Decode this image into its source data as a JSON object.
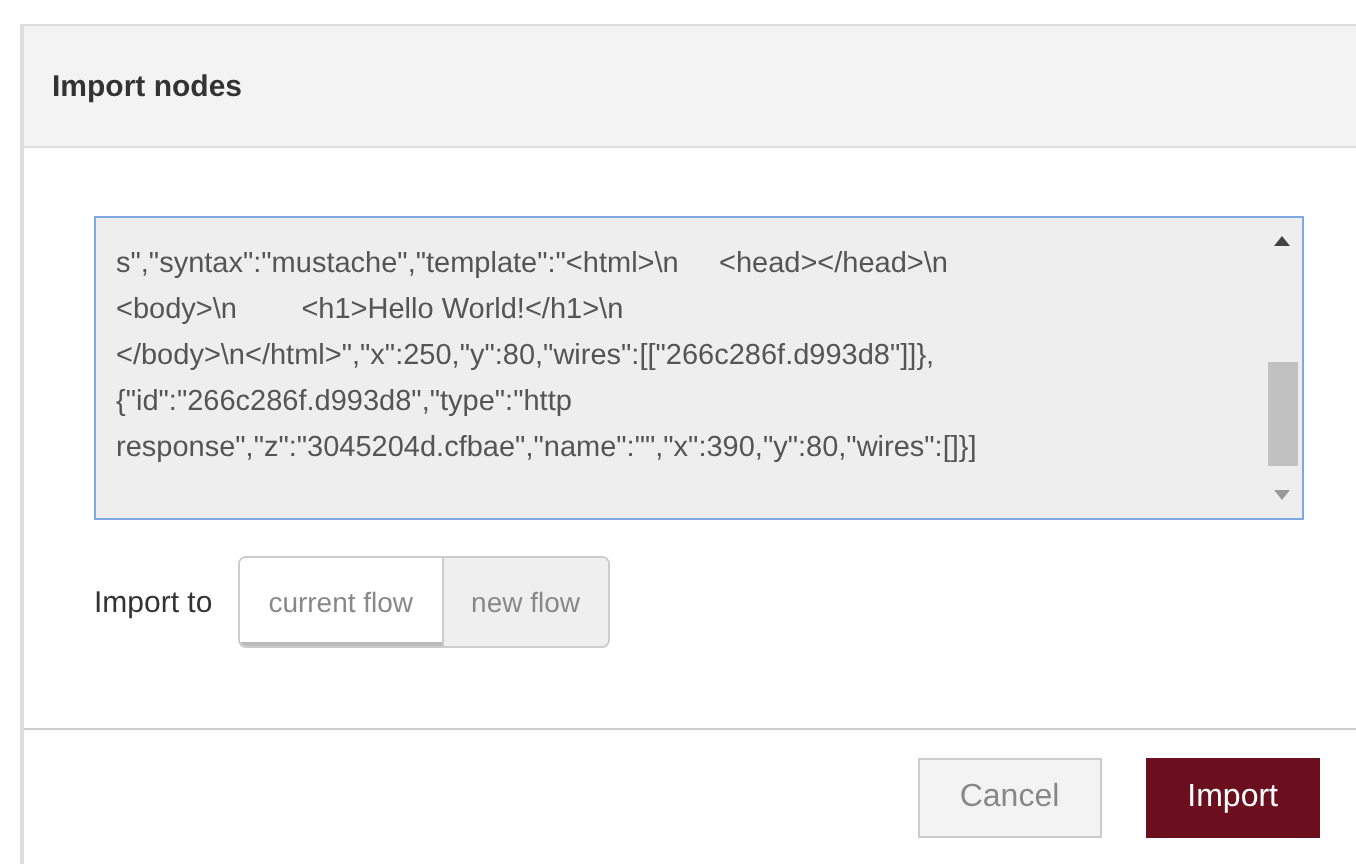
{
  "dialog": {
    "title": "Import nodes"
  },
  "editor": {
    "lines": [
      "s\",\"syntax\":\"mustache\",\"template\":\"<html>\\n     <head></head>\\n",
      "<body>\\n        <h1>Hello World!</h1>\\n",
      "</body>\\n</html>\",\"x\":250,\"y\":80,\"wires\":[[\"266c286f.d993d8\"]]},",
      "{\"id\":\"266c286f.d993d8\",\"type\":\"http",
      "response\",\"z\":\"3045204d.cfbae\",\"name\":\"\",\"x\":390,\"y\":80,\"wires\":[]}]"
    ]
  },
  "import_to": {
    "label": "Import to",
    "options": [
      {
        "label": "current flow",
        "selected": true
      },
      {
        "label": "new flow",
        "selected": false
      }
    ]
  },
  "buttons": [
    {
      "label": "Cancel",
      "kind": "secondary"
    },
    {
      "label": "Import",
      "kind": "primary"
    }
  ]
}
